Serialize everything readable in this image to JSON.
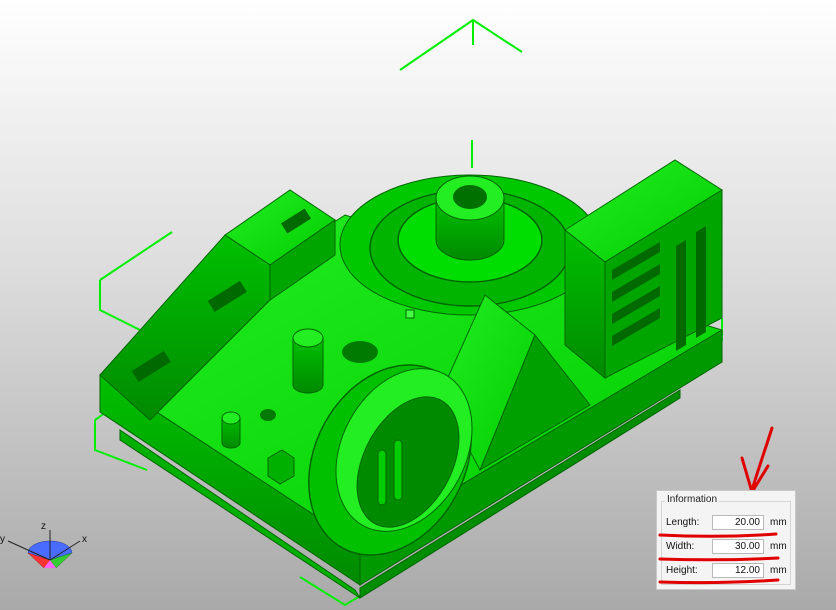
{
  "colors": {
    "model_green": "#00dd00",
    "model_dark": "#008800",
    "annotation_red": "#e00000"
  },
  "axes": {
    "x": "x",
    "y": "y",
    "z": "z"
  },
  "info_panel": {
    "title": "Information",
    "rows": [
      {
        "label": "Length:",
        "value": "20.00",
        "unit": "mm"
      },
      {
        "label": "Width:",
        "value": "30.00",
        "unit": "mm"
      },
      {
        "label": "Height:",
        "value": "12.00",
        "unit": "mm"
      }
    ]
  }
}
